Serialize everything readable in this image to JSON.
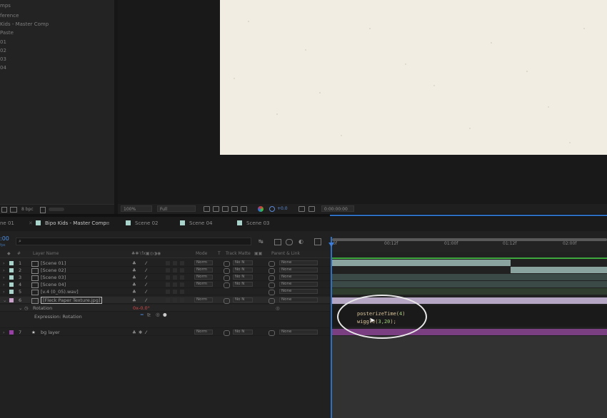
{
  "project_panel": {
    "items": [
      "mps",
      "ference",
      "Kids - Master Comp",
      "Paste",
      "01",
      "02",
      "03",
      "04"
    ],
    "footer": {
      "bpc": "8 bpc"
    }
  },
  "viewer": {
    "zoom": "100%",
    "resolution": "Full",
    "exposure": "+0.0",
    "timecode": "0:00:00:00"
  },
  "timeline_tabs": {
    "left_partial": "ne 01",
    "active": "Bipo Kids - Master Comp",
    "tabs": [
      "Scene 02",
      "Scene 04",
      "Scene 03"
    ],
    "swatch_color": "#a9d4cc"
  },
  "timeline": {
    "current_time": ":00",
    "fps_hint": "fps",
    "search_placeholder": "",
    "columns": {
      "layer_name": "Layer Name",
      "mode": "Mode",
      "t": "T",
      "track_matte": "Track Matte",
      "parent_link": "Parent & Link"
    },
    "ruler": [
      "0f",
      "00:12f",
      "01:00f",
      "01:12f",
      "02:00f"
    ],
    "layers": [
      {
        "num": "1",
        "name": "[Scene 01]",
        "mode": "Norm",
        "matte": "No N",
        "parent": "None",
        "color": "#a9d4cc"
      },
      {
        "num": "2",
        "name": "[Scene 02]",
        "mode": "Norm",
        "matte": "No N",
        "parent": "None",
        "color": "#a9d4cc"
      },
      {
        "num": "3",
        "name": "[Scene 03]",
        "mode": "Norm",
        "matte": "No N",
        "parent": "None",
        "color": "#a9d4cc"
      },
      {
        "num": "4",
        "name": "[Scene 04]",
        "mode": "Norm",
        "matte": "No N",
        "parent": "None",
        "color": "#a9d4cc"
      },
      {
        "num": "5",
        "name": "[v.4 (0_05).wav]",
        "mode": "",
        "matte": "",
        "parent": "None",
        "color": "#a9d4cc"
      },
      {
        "num": "6",
        "name": "[Fleck Paper Texture.jpg]",
        "mode": "Norm",
        "matte": "No N",
        "parent": "None",
        "color": "#c9a0c9"
      }
    ],
    "rotation": {
      "label": "Rotation",
      "value": "0x-0.0°"
    },
    "expression_label": "Expression: Rotation",
    "bg_layer": {
      "num": "7",
      "name": "bg layer",
      "mode": "Norm",
      "matte": "No N",
      "parent": "None",
      "color": "#9b3fa8"
    },
    "expression": {
      "line1_fn": "posterizeTime(",
      "line1_num": "4",
      "line1_end": ")",
      "line2_fn": "wiggle(",
      "line2_num": "3,20",
      "line2_end": ");"
    }
  }
}
